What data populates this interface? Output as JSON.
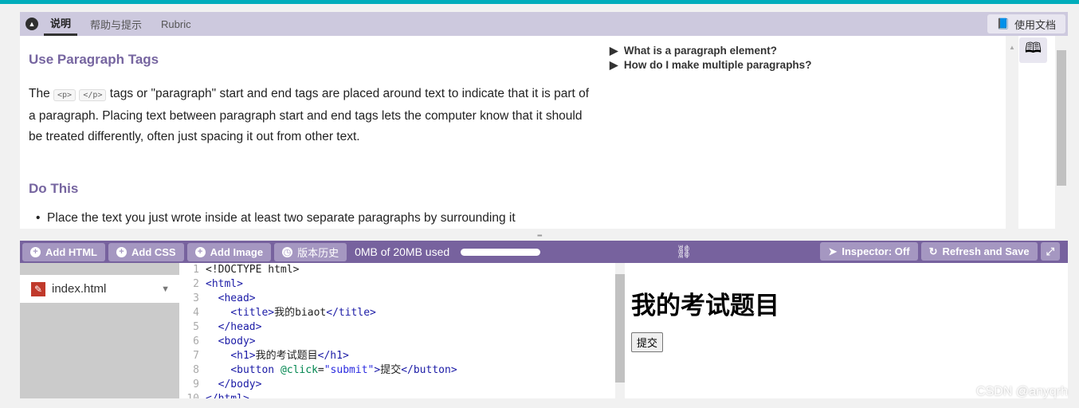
{
  "tabs": {
    "items": [
      "说明",
      "帮助与提示",
      "Rubric"
    ],
    "docs": "使用文档"
  },
  "instructions": {
    "title": "Use Paragraph Tags",
    "p_before": "The ",
    "code1": "<p>",
    "code2": "</p>",
    "p_after": " tags or \"paragraph\" start and end tags are placed around text to indicate that it is part of a paragraph. Placing text between paragraph start and end tags lets the computer know that it should be treated differently, often just spacing it out from other text.",
    "do_title": "Do This",
    "bullet": "Place the text you just wrote inside at least two separate paragraphs by surrounding it",
    "faq": [
      "What is a paragraph element?",
      "How do I make multiple paragraphs?"
    ]
  },
  "toolbar": {
    "add_html": "Add HTML",
    "add_css": "Add CSS",
    "add_image": "Add Image",
    "history": "版本历史",
    "usage": "0MB of 20MB used",
    "usage_fraction": 0,
    "inspector": "Inspector: Off",
    "refresh": "Refresh and Save"
  },
  "files": {
    "current": "index.html"
  },
  "editor": {
    "lines": [
      [
        [
          "tx",
          "<!DOCTYPE html>"
        ]
      ],
      [
        [
          "tg",
          "<html>"
        ]
      ],
      [
        [
          "tx",
          "  "
        ],
        [
          "tg",
          "<head>"
        ]
      ],
      [
        [
          "tx",
          "    "
        ],
        [
          "tg",
          "<title>"
        ],
        [
          "tx",
          "我的biaot"
        ],
        [
          "tg",
          "</title>"
        ]
      ],
      [
        [
          "tx",
          "  "
        ],
        [
          "tg",
          "</head>"
        ]
      ],
      [
        [
          "tx",
          "  "
        ],
        [
          "tg",
          "<body>"
        ]
      ],
      [
        [
          "tx",
          "    "
        ],
        [
          "tg",
          "<h1>"
        ],
        [
          "tx",
          "我的考试题目"
        ],
        [
          "tg",
          "</h1>"
        ]
      ],
      [
        [
          "tx",
          "    "
        ],
        [
          "tg",
          "<button "
        ],
        [
          "at",
          "@click"
        ],
        [
          "tx",
          "="
        ],
        [
          "st",
          "\"submit\""
        ],
        [
          "tg",
          ">"
        ],
        [
          "tx",
          "提交"
        ],
        [
          "tg",
          "</button>"
        ]
      ],
      [
        [
          "tx",
          "  "
        ],
        [
          "tg",
          "</body>"
        ]
      ],
      [
        [
          "tg",
          "</html>"
        ]
      ]
    ]
  },
  "preview": {
    "heading": "我的考试题目",
    "button": "提交"
  },
  "watermark": "CSDN @anyqrh"
}
